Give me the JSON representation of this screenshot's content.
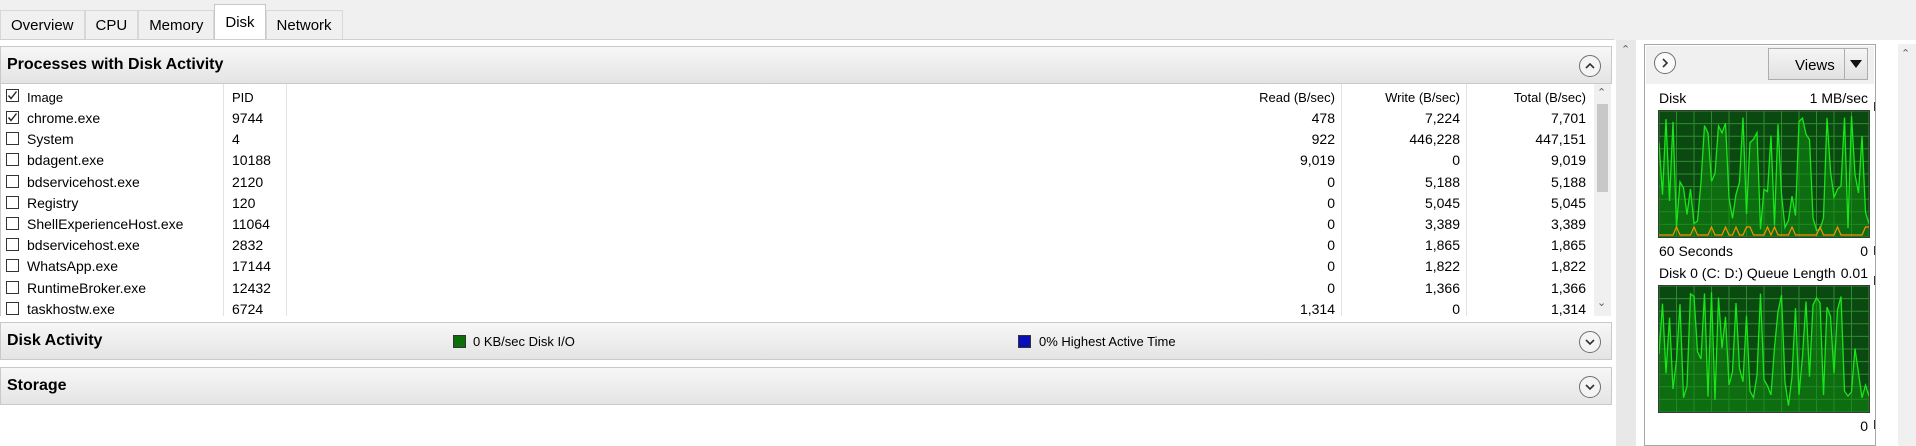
{
  "tabs": [
    {
      "label": "Overview"
    },
    {
      "label": "CPU"
    },
    {
      "label": "Memory"
    },
    {
      "label": "Disk",
      "active": true
    },
    {
      "label": "Network"
    }
  ],
  "processes_section": {
    "title": "Processes with Disk Activity",
    "columns": {
      "image": "Image",
      "pid": "PID",
      "read": "Read (B/sec)",
      "write": "Write (B/sec)",
      "total": "Total (B/sec)"
    },
    "rows": [
      {
        "checked": true,
        "image": "chrome.exe",
        "pid": "9744",
        "read": "478",
        "write": "7,224",
        "total": "7,701"
      },
      {
        "checked": false,
        "image": "System",
        "pid": "4",
        "read": "922",
        "write": "446,228",
        "total": "447,151"
      },
      {
        "checked": false,
        "image": "bdagent.exe",
        "pid": "10188",
        "read": "9,019",
        "write": "0",
        "total": "9,019"
      },
      {
        "checked": false,
        "image": "bdservicehost.exe",
        "pid": "2120",
        "read": "0",
        "write": "5,188",
        "total": "5,188"
      },
      {
        "checked": false,
        "image": "Registry",
        "pid": "120",
        "read": "0",
        "write": "5,045",
        "total": "5,045"
      },
      {
        "checked": false,
        "image": "ShellExperienceHost.exe",
        "pid": "11064",
        "read": "0",
        "write": "3,389",
        "total": "3,389"
      },
      {
        "checked": false,
        "image": "bdservicehost.exe",
        "pid": "2832",
        "read": "0",
        "write": "1,865",
        "total": "1,865"
      },
      {
        "checked": false,
        "image": "WhatsApp.exe",
        "pid": "17144",
        "read": "0",
        "write": "1,822",
        "total": "1,822"
      },
      {
        "checked": false,
        "image": "RuntimeBroker.exe",
        "pid": "12432",
        "read": "0",
        "write": "1,366",
        "total": "1,366"
      },
      {
        "checked": false,
        "image": "taskhostw.exe",
        "pid": "6724",
        "read": "1,314",
        "write": "0",
        "total": "1,314"
      }
    ]
  },
  "disk_activity": {
    "title": "Disk Activity",
    "io_label": "0 KB/sec Disk I/O",
    "io_color": "#0b6e0b",
    "active_label": "0% Highest Active Time",
    "active_color": "#0a10b8"
  },
  "storage": {
    "title": "Storage"
  },
  "right_panel": {
    "views_label": "Views",
    "graph1": {
      "title": "Disk",
      "max": "1 MB/sec",
      "time": "60 Seconds",
      "min": "0"
    },
    "graph2": {
      "title": "Disk 0 (C: D:) Queue Length",
      "max": "0.01",
      "min": "0"
    }
  },
  "colors": {
    "graph_bg": "#0a4a10",
    "graph_line": "#19e619",
    "graph_grid": "#2f8a2f",
    "orange": "#ff8c00"
  }
}
